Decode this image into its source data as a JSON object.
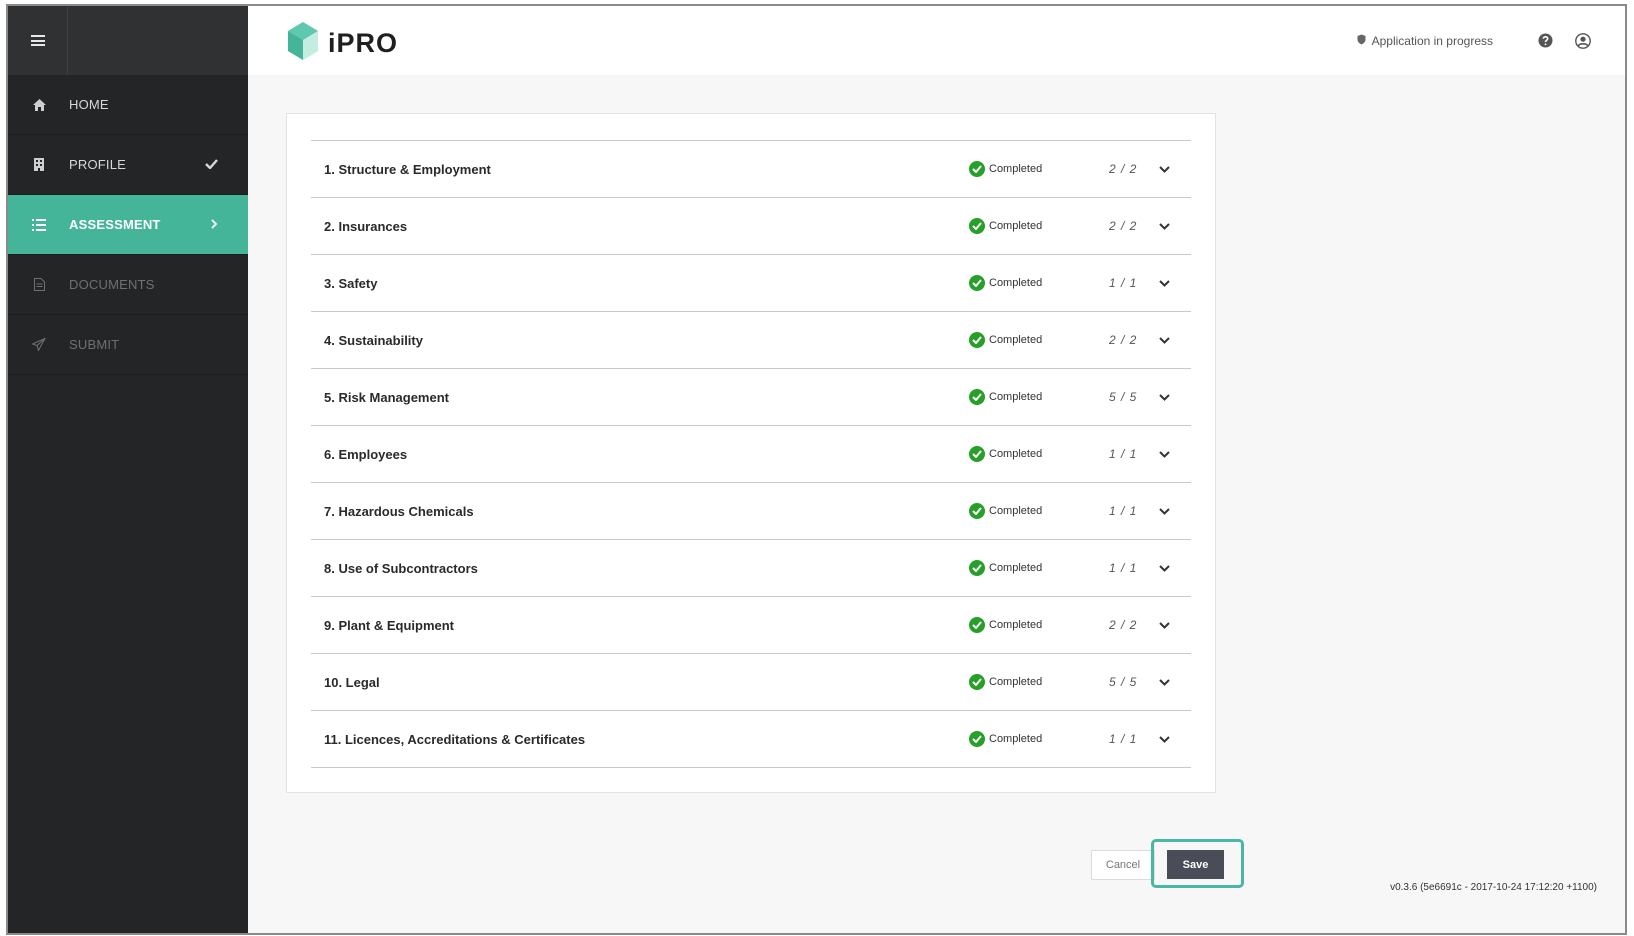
{
  "app": {
    "name": "iPRO",
    "accent_color": "#45b59a",
    "logo_icon": "hexagon-logo-icon"
  },
  "sidebar": {
    "items": [
      {
        "label": "HOME",
        "icon": "home-icon",
        "state": "normal"
      },
      {
        "label": "PROFILE",
        "icon": "building-icon",
        "state": "done",
        "right_icon": "check-icon"
      },
      {
        "label": "ASSESSMENT",
        "icon": "list-icon",
        "state": "active",
        "right_icon": "chevron-right-icon"
      },
      {
        "label": "DOCUMENTS",
        "icon": "document-icon",
        "state": "disabled"
      },
      {
        "label": "SUBMIT",
        "icon": "send-icon",
        "state": "disabled"
      }
    ]
  },
  "header": {
    "status_text": "Application in progress",
    "status_icon": "shield-icon",
    "help_icon": "help-icon",
    "user_icon": "user-icon"
  },
  "sections": [
    {
      "title": "1. Structure & Employment",
      "status": "Completed",
      "progress": "2 / 2"
    },
    {
      "title": "2. Insurances",
      "status": "Completed",
      "progress": "2 / 2"
    },
    {
      "title": "3. Safety",
      "status": "Completed",
      "progress": "1 / 1"
    },
    {
      "title": "4. Sustainability",
      "status": "Completed",
      "progress": "2 / 2"
    },
    {
      "title": "5. Risk Management",
      "status": "Completed",
      "progress": "5 / 5"
    },
    {
      "title": "6. Employees",
      "status": "Completed",
      "progress": "1 / 1"
    },
    {
      "title": "7. Hazardous Chemicals",
      "status": "Completed",
      "progress": "1 / 1"
    },
    {
      "title": "8. Use of Subcontractors",
      "status": "Completed",
      "progress": "1 / 1"
    },
    {
      "title": "9. Plant & Equipment",
      "status": "Completed",
      "progress": "2 / 2"
    },
    {
      "title": "10. Legal",
      "status": "Completed",
      "progress": "5 / 5"
    },
    {
      "title": "11. Licences, Accreditations & Certificates",
      "status": "Completed",
      "progress": "1 / 1"
    }
  ],
  "actions": {
    "cancel_label": "Cancel",
    "save_label": "Save"
  },
  "footer": {
    "version": "v0.3.6 (5e6691c - 2017-10-24 17:12:20 +1100)"
  }
}
